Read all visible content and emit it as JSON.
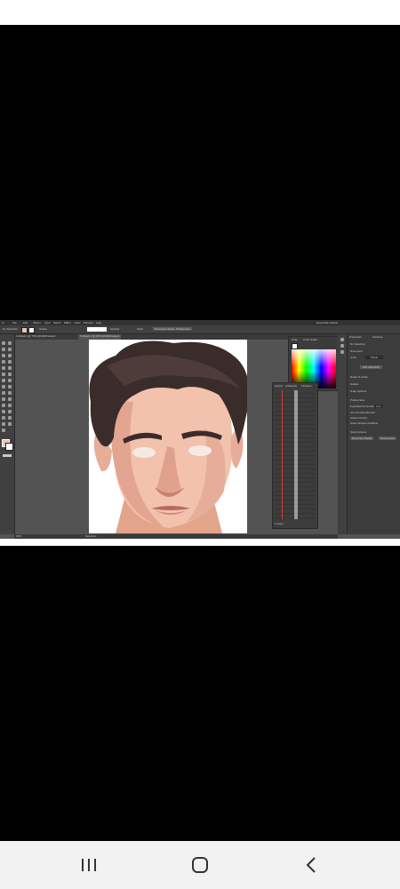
{
  "app": {
    "menu": [
      "Ai",
      "File",
      "Edit",
      "Object",
      "Type",
      "Select",
      "Effect",
      "View",
      "Window",
      "Help"
    ],
    "workspace_label": "Essentials Classic",
    "tabs": [
      "Untitled-1 @ 75% (RGB/Preview)",
      "Untitled-1 @ 40% (RGB/Preview)"
    ],
    "control_bar": {
      "selection_label": "No Selection",
      "stroke_label": "Stroke",
      "opacity_label": "Opacity:",
      "style_label": "Style:",
      "document_setup": "Document Setup",
      "preferences": "Preferences"
    },
    "status": {
      "zoom": "33%",
      "mode": "Selection"
    },
    "color_panel": {
      "tabs": [
        "Color",
        "Color Guide"
      ]
    },
    "layers_panel": {
      "tabs": [
        "Layers",
        "Artboards",
        "Libraries"
      ],
      "footer": "1 Layer"
    },
    "properties_panel": {
      "tabs": [
        "Properties",
        "Libraries"
      ],
      "sections": [
        "No Selection",
        "Document",
        "Units",
        "Pixels",
        "Edit Artboards",
        "Rulers & Grids",
        "Guides",
        "Snap Options",
        "Preferences",
        "Keyboard Increment",
        "Use Preview Bounds",
        "Scale Corners",
        "Scale Strokes & Effects",
        "Quick Actions",
        "Document Setup",
        "Preferences"
      ],
      "keyboard_increment_value": "1 px"
    },
    "colors": {
      "panel_bg": "#3c3c3c",
      "canvas_bg": "#535353",
      "accent_active_tab": "#535353"
    }
  },
  "android_nav": {
    "recent_icon": "recent-apps-icon",
    "home_icon": "home-icon",
    "back_icon": "back-icon"
  }
}
